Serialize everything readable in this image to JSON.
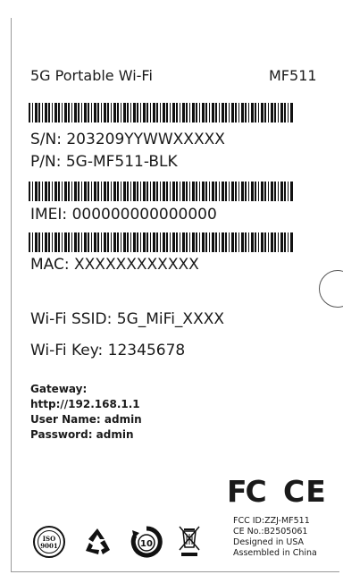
{
  "header": {
    "product_name": "5G Portable Wi-Fi",
    "model": "MF511"
  },
  "identifiers": {
    "serial": "S/N: 203209YYWWXXXXX",
    "part_number": "P/N: 5G-MF511-BLK",
    "imei": "IMEI: 000000000000000",
    "mac": "MAC: XXXXXXXXXXXX"
  },
  "wifi": {
    "ssid": "Wi-Fi SSID: 5G_MiFi_XXXX",
    "key": "Wi-Fi Key: 12345678"
  },
  "admin": {
    "gateway_label": "Gateway:",
    "gateway_url": "http://192.168.1.1",
    "username": "User Name: admin",
    "password": "Password: admin"
  },
  "certification": {
    "fcc_logo": "FC",
    "ce_logo": "CE",
    "fcc_id": "FCC ID:ZZJ-MF511",
    "ce_no": "CE No.:B2505061",
    "designed": "Designed in USA",
    "assembled": "Assembled in China",
    "iso_text": "ISO",
    "iso_number": "9001",
    "recycle_number": "10"
  },
  "icons": [
    "barcode-icon",
    "iso-9001-seal-icon",
    "recycle-icon",
    "ten-year-recycle-icon",
    "crossed-bin-icon"
  ],
  "colors": {
    "text": "#1a1a1a",
    "background": "#ffffff"
  }
}
